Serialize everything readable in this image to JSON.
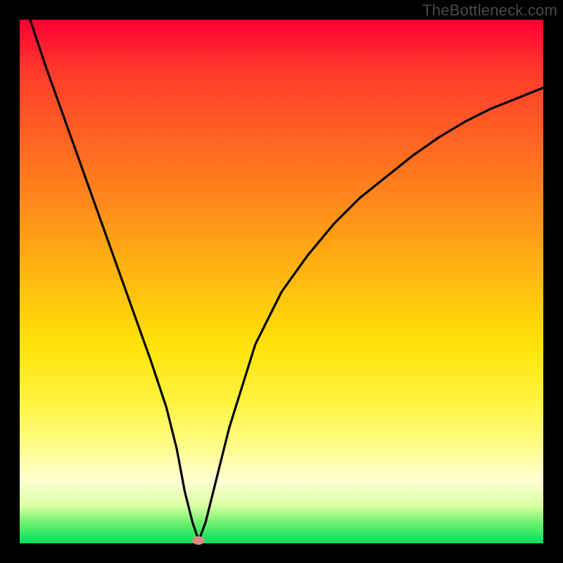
{
  "watermark": "TheBottleneck.com",
  "chart_data": {
    "type": "line",
    "title": "",
    "xlabel": "",
    "ylabel": "",
    "xlim": [
      0,
      100
    ],
    "ylim": [
      0,
      100
    ],
    "grid": false,
    "series": [
      {
        "name": "bottleneck-curve",
        "x": [
          2,
          5,
          10,
          15,
          20,
          25,
          28,
          30,
          31.5,
          33,
          34.2,
          35.5,
          37,
          40,
          45,
          50,
          55,
          60,
          65,
          70,
          75,
          80,
          85,
          90,
          95,
          100
        ],
        "values": [
          100,
          91,
          77,
          63,
          49,
          35,
          26,
          18,
          10,
          4,
          0.5,
          4,
          10,
          22,
          38,
          48,
          55,
          61,
          66,
          70,
          74,
          77.5,
          80.5,
          83,
          85,
          87
        ]
      }
    ],
    "marker": {
      "x": 34.2,
      "y": 0.5,
      "shape": "ellipse",
      "color": "#d98b82"
    },
    "background_gradient": {
      "stops": [
        {
          "pos": 0,
          "color": "#ff0033"
        },
        {
          "pos": 25,
          "color": "#ff6a22"
        },
        {
          "pos": 52,
          "color": "#ffc20d"
        },
        {
          "pos": 80,
          "color": "#fffb7a"
        },
        {
          "pos": 100,
          "color": "#00e060"
        }
      ]
    }
  }
}
